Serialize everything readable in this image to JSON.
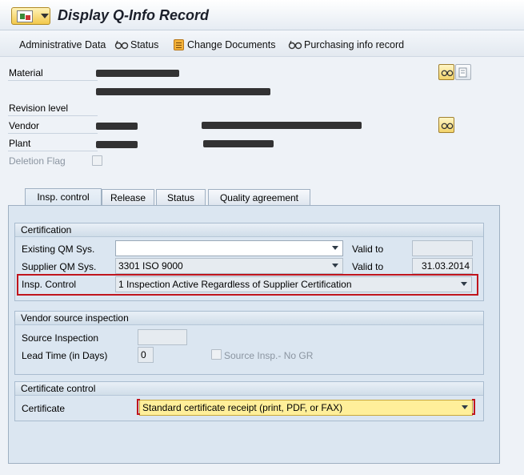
{
  "window": {
    "title": "Display Q-Info Record"
  },
  "toolbar": {
    "administrative_data": "Administrative Data",
    "status": "Status",
    "change_documents": "Change Documents",
    "purchasing_info_record": "Purchasing info record"
  },
  "header": {
    "material_label": "Material",
    "revision_label": "Revision level",
    "vendor_label": "Vendor",
    "plant_label": "Plant",
    "deletion_flag_label": "Deletion Flag",
    "deletion_flag_checked": false
  },
  "tabs": [
    {
      "label": "Insp. control",
      "active": true
    },
    {
      "label": "Release",
      "active": false
    },
    {
      "label": "Status",
      "active": false
    },
    {
      "label": "Quality agreement",
      "active": false
    }
  ],
  "certification": {
    "title": "Certification",
    "existing_qm_label": "Existing QM Sys.",
    "existing_qm_value": "",
    "valid_to_label_1": "Valid to",
    "valid_to_value_1": "",
    "supplier_qm_label": "Supplier QM Sys.",
    "supplier_qm_value": "3301 ISO 9000",
    "valid_to_label_2": "Valid to",
    "valid_to_value_2": "31.03.2014",
    "insp_control_label": "Insp. Control",
    "insp_control_value": "1 Inspection Active Regardless of Supplier Certification"
  },
  "vendor_source": {
    "title": "Vendor source inspection",
    "source_inspection_label": "Source Inspection",
    "source_inspection_value": "",
    "lead_time_label": "Lead Time (in Days)",
    "lead_time_value": "0",
    "source_insp_no_gr_label": "Source Insp.- No GR",
    "source_insp_no_gr_checked": false
  },
  "certificate_control": {
    "title": "Certificate control",
    "certificate_label": "Certificate",
    "certificate_value": "Standard certificate receipt (print, PDF, or FAX)"
  },
  "colors": {
    "highlight_box": "#c0151d",
    "certificate_field": "#ffef9a",
    "panel_bg": "#dbe6f1"
  }
}
